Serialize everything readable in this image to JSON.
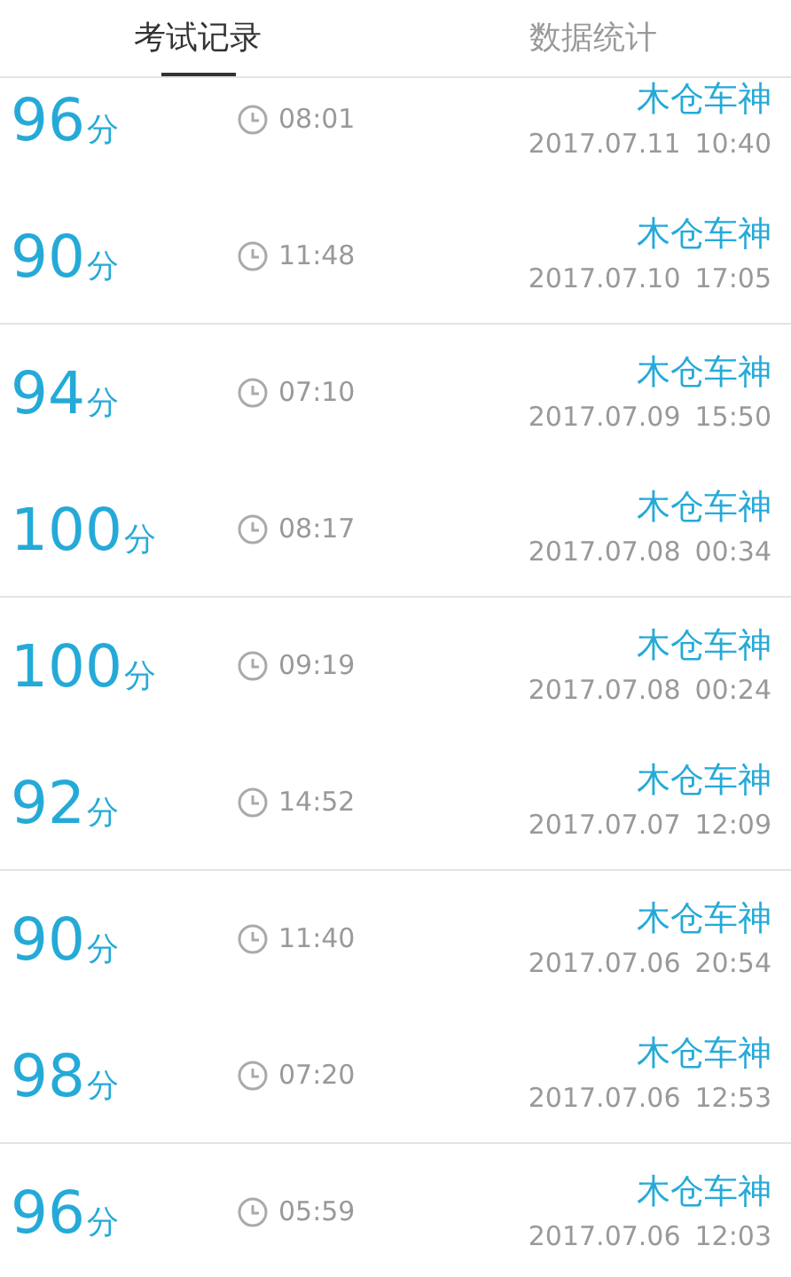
{
  "tabs": [
    {
      "label": "考试记录",
      "selected": true
    },
    {
      "label": "数据统计",
      "selected": false
    }
  ],
  "records": [
    {
      "score": "96",
      "unit": "分",
      "duration": "08:01",
      "name": "木仓车神",
      "date": "2017.07.11",
      "time": "10:40"
    },
    {
      "score": "90",
      "unit": "分",
      "duration": "11:48",
      "name": "木仓车神",
      "date": "2017.07.10",
      "time": "17:05"
    },
    {
      "score": "94",
      "unit": "分",
      "duration": "07:10",
      "name": "木仓车神",
      "date": "2017.07.09",
      "time": "15:50"
    },
    {
      "score": "100",
      "unit": "分",
      "duration": "08:17",
      "name": "木仓车神",
      "date": "2017.07.08",
      "time": "00:34"
    },
    {
      "score": "100",
      "unit": "分",
      "duration": "09:19",
      "name": "木仓车神",
      "date": "2017.07.08",
      "time": "00:24"
    },
    {
      "score": "92",
      "unit": "分",
      "duration": "14:52",
      "name": "木仓车神",
      "date": "2017.07.07",
      "time": "12:09"
    },
    {
      "score": "90",
      "unit": "分",
      "duration": "11:40",
      "name": "木仓车神",
      "date": "2017.07.06",
      "time": "20:54"
    },
    {
      "score": "98",
      "unit": "分",
      "duration": "07:20",
      "name": "木仓车神",
      "date": "2017.07.06",
      "time": "12:53"
    },
    {
      "score": "96",
      "unit": "分",
      "duration": "05:59",
      "name": "木仓车神",
      "date": "2017.07.06",
      "time": "12:03"
    }
  ]
}
